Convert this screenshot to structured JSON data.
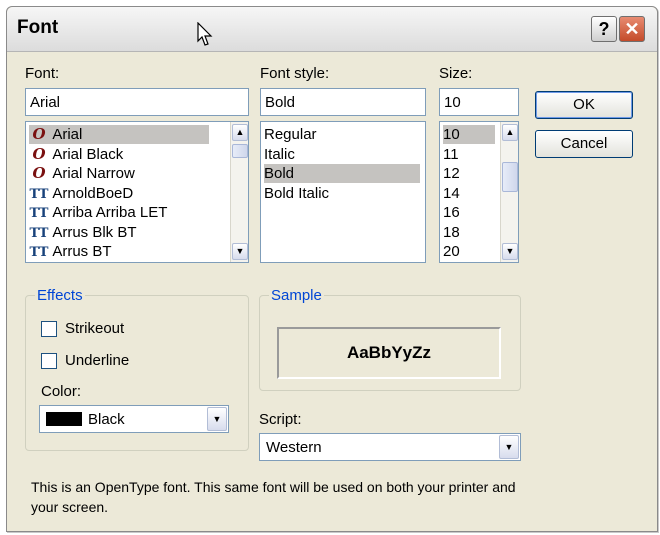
{
  "window": {
    "title": "Font",
    "help_glyph": "?",
    "close_glyph": "✕"
  },
  "font": {
    "label": "Font:",
    "value": "Arial",
    "items": [
      {
        "name": "Arial",
        "icon": "opentype-icon",
        "glyph": "O",
        "selected": true
      },
      {
        "name": "Arial Black",
        "icon": "opentype-icon",
        "glyph": "O",
        "selected": false
      },
      {
        "name": "Arial Narrow",
        "icon": "opentype-icon",
        "glyph": "O",
        "selected": false
      },
      {
        "name": "ArnoldBoeD",
        "icon": "truetype-icon",
        "glyph": "TT",
        "selected": false
      },
      {
        "name": "Arriba Arriba LET",
        "icon": "truetype-icon",
        "glyph": "TT",
        "selected": false
      },
      {
        "name": "Arrus Blk BT",
        "icon": "truetype-icon",
        "glyph": "TT",
        "selected": false
      },
      {
        "name": "Arrus BT",
        "icon": "truetype-icon",
        "glyph": "TT",
        "selected": false
      }
    ]
  },
  "style": {
    "label": "Font style:",
    "value": "Bold",
    "items": [
      "Regular",
      "Italic",
      "Bold",
      "Bold Italic"
    ],
    "selected_index": 2
  },
  "size": {
    "label": "Size:",
    "value": "10",
    "items": [
      "10",
      "11",
      "12",
      "14",
      "16",
      "18",
      "20"
    ],
    "selected_index": 0
  },
  "buttons": {
    "ok": "OK",
    "cancel": "Cancel"
  },
  "effects": {
    "label": "Effects",
    "strikeout": "Strikeout",
    "underline": "Underline",
    "color_label": "Color:",
    "color_value": "Black",
    "strikeout_checked": false,
    "underline_checked": false
  },
  "sample": {
    "label": "Sample",
    "text": "AaBbYyZz"
  },
  "script": {
    "label": "Script:",
    "value": "Western"
  },
  "info": "This is an OpenType font. This same font will be used on both your printer and your screen."
}
